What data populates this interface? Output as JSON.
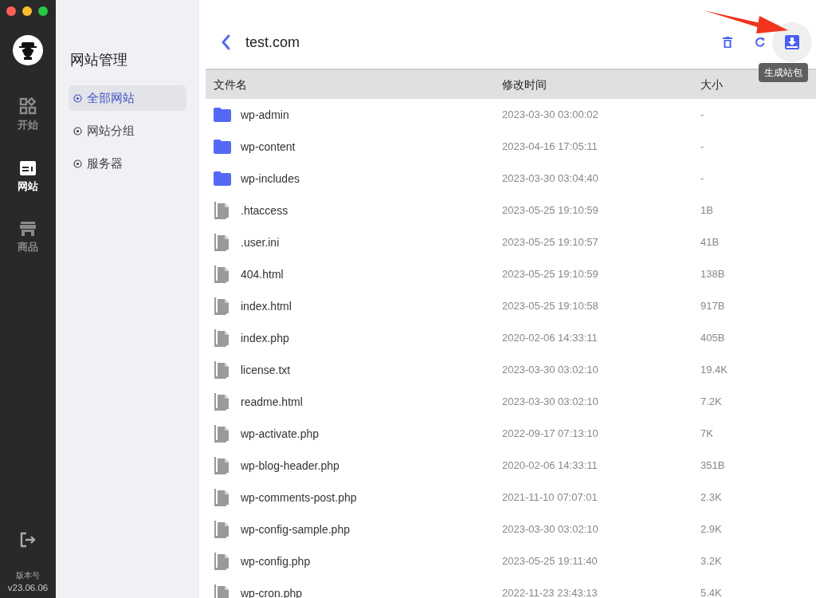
{
  "rail": {
    "items": [
      {
        "label": "开始",
        "kind": "grid",
        "selected": false
      },
      {
        "label": "网站",
        "kind": "site",
        "selected": true
      },
      {
        "label": "商品",
        "kind": "store",
        "selected": false
      }
    ],
    "version_label": "版本号",
    "version": "v23.06.06"
  },
  "sidebar": {
    "title": "网站管理",
    "items": [
      {
        "label": "全部网站",
        "selected": true
      },
      {
        "label": "网站分组",
        "selected": false
      },
      {
        "label": "服务器",
        "selected": false
      }
    ]
  },
  "header": {
    "title": "test.com",
    "tooltip": "生成站包"
  },
  "table": {
    "columns": [
      "文件名",
      "修改时间",
      "大小"
    ],
    "rows": [
      {
        "kind": "folder",
        "name": "wp-admin",
        "modified": "2023-03-30 03:00:02",
        "size": "-"
      },
      {
        "kind": "folder",
        "name": "wp-content",
        "modified": "2023-04-16 17:05:11",
        "size": "-"
      },
      {
        "kind": "folder",
        "name": "wp-includes",
        "modified": "2023-03-30 03:04:40",
        "size": "-"
      },
      {
        "kind": "file",
        "name": ".htaccess",
        "modified": "2023-05-25 19:10:59",
        "size": "1B"
      },
      {
        "kind": "file",
        "name": ".user.ini",
        "modified": "2023-05-25 19:10:57",
        "size": "41B"
      },
      {
        "kind": "file",
        "name": "404.html",
        "modified": "2023-05-25 19:10:59",
        "size": "138B"
      },
      {
        "kind": "file",
        "name": "index.html",
        "modified": "2023-05-25 19:10:58",
        "size": "917B"
      },
      {
        "kind": "file",
        "name": "index.php",
        "modified": "2020-02-06 14:33:11",
        "size": "405B"
      },
      {
        "kind": "file",
        "name": "license.txt",
        "modified": "2023-03-30 03:02:10",
        "size": "19.4K"
      },
      {
        "kind": "file",
        "name": "readme.html",
        "modified": "2023-03-30 03:02:10",
        "size": "7.2K"
      },
      {
        "kind": "file",
        "name": "wp-activate.php",
        "modified": "2022-09-17 07:13:10",
        "size": "7K"
      },
      {
        "kind": "file",
        "name": "wp-blog-header.php",
        "modified": "2020-02-06 14:33:11",
        "size": "351B"
      },
      {
        "kind": "file",
        "name": "wp-comments-post.php",
        "modified": "2021-11-10 07:07:01",
        "size": "2.3K"
      },
      {
        "kind": "file",
        "name": "wp-config-sample.php",
        "modified": "2023-03-30 03:02:10",
        "size": "2.9K"
      },
      {
        "kind": "file",
        "name": "wp-config.php",
        "modified": "2023-05-25 19:11:40",
        "size": "3.2K"
      },
      {
        "kind": "file",
        "name": "wp-cron.php",
        "modified": "2022-11-23 23:43:13",
        "size": "5.4K"
      }
    ]
  }
}
